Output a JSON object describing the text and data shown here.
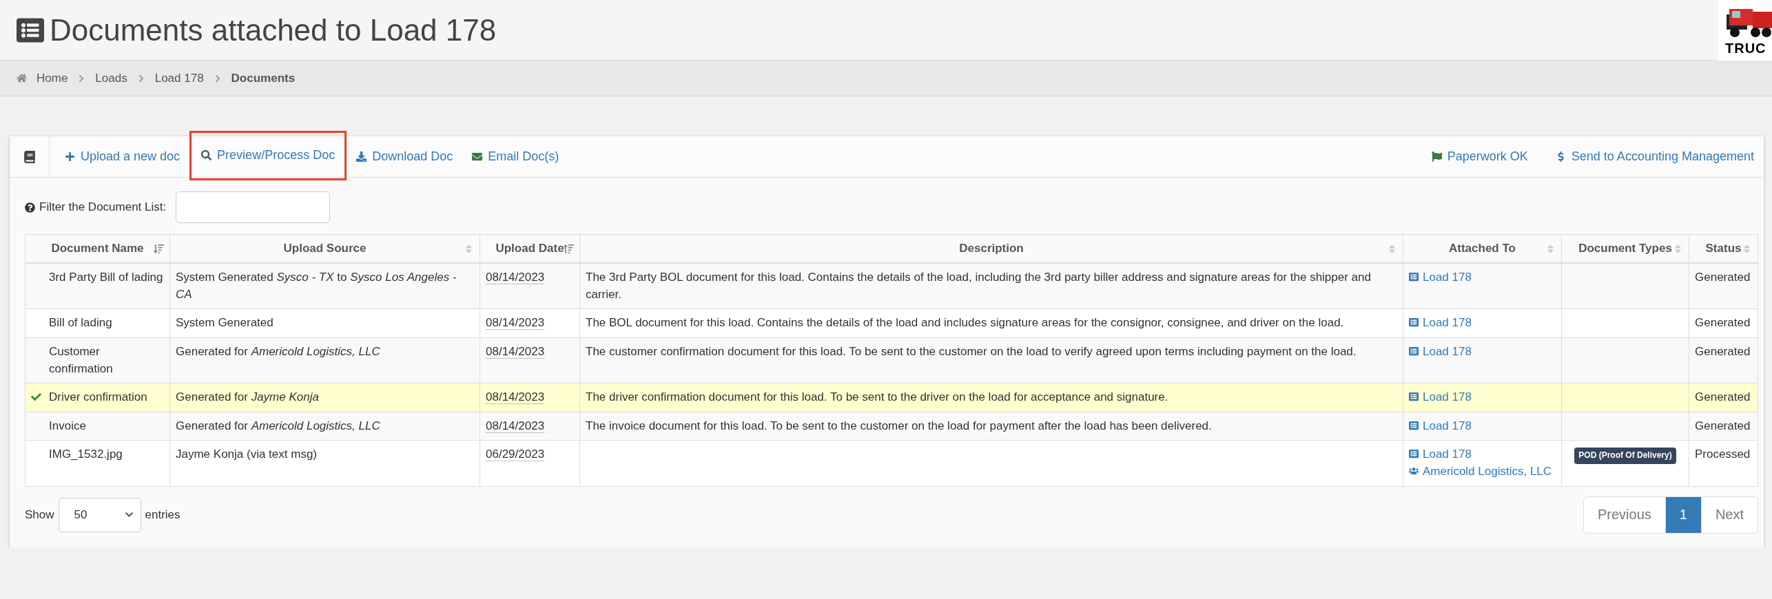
{
  "header": {
    "title": "Documents attached to Load 178",
    "logo_text": "TRUC"
  },
  "breadcrumb": [
    {
      "label": "Home",
      "kind": "home",
      "current": false
    },
    {
      "label": "Loads",
      "kind": "link",
      "current": false
    },
    {
      "label": "Load 178",
      "kind": "link",
      "current": false
    },
    {
      "label": "Documents",
      "kind": "link",
      "current": true
    }
  ],
  "toolbar": {
    "left": [
      {
        "label": "Upload a new doc",
        "highlighted": false
      },
      {
        "label": "Preview/Process Doc",
        "highlighted": true
      },
      {
        "label": "Download Doc",
        "highlighted": false
      },
      {
        "label": "Email Doc(s)",
        "highlighted": false
      }
    ],
    "right": [
      {
        "label": "Paperwork OK",
        "highlighted": false
      },
      {
        "label": "Send to Accounting Management",
        "highlighted": false
      }
    ]
  },
  "filter": {
    "label": "Filter the Document List:"
  },
  "table": {
    "columns": [
      {
        "label": "Document Name",
        "sorted": true,
        "descending": false
      },
      {
        "label": "Upload Source",
        "sorted": false
      },
      {
        "label": "Upload Date",
        "sorted": true,
        "descending": true
      },
      {
        "label": "Description",
        "sorted": false
      },
      {
        "label": "Attached To",
        "sorted": false
      },
      {
        "label": "Document Types",
        "sorted": false
      },
      {
        "label": "Status",
        "sorted": false
      }
    ],
    "rows": [
      {
        "name": "3rd Party Bill of lading",
        "source": "System Generated *Sysco - TX* to *Sysco Los Angeles - CA*",
        "date": "08/14/2023",
        "description": "The 3rd Party BOL document for this load. Contains the details of the load, including the 3rd party biller address and signature areas for the shipper and carrier.",
        "attached": [
          {
            "label": "Load 178",
            "kind": "load"
          }
        ],
        "status": "Generated",
        "selected": false
      },
      {
        "name": "Bill of lading",
        "source": "System Generated",
        "date": "08/14/2023",
        "description": "The BOL document for this load. Contains the details of the load and includes signature areas for the consignor, consignee, and driver on the load.",
        "attached": [
          {
            "label": "Load 178",
            "kind": "load"
          }
        ],
        "status": "Generated",
        "selected": false
      },
      {
        "name": "Customer confirmation",
        "source": "Generated for *Americold Logistics, LLC*",
        "date": "08/14/2023",
        "description": "The customer confirmation document for this load. To be sent to the customer on the load to verify agreed upon terms including payment on the load.",
        "attached": [
          {
            "label": "Load 178",
            "kind": "load"
          }
        ],
        "status": "Generated",
        "selected": false
      },
      {
        "name": "Driver confirmation",
        "source": "Generated for *Jayme Konja*",
        "date": "08/14/2023",
        "description": "The driver confirmation document for this load. To be sent to the driver on the load for acceptance and signature.",
        "attached": [
          {
            "label": "Load 178",
            "kind": "load"
          }
        ],
        "status": "Generated",
        "selected": true
      },
      {
        "name": "Invoice",
        "source": "Generated for *Americold Logistics, LLC*",
        "date": "08/14/2023",
        "description": "The invoice document for this load. To be sent to the customer on the load for payment after the load has been delivered.",
        "attached": [
          {
            "label": "Load 178",
            "kind": "load"
          }
        ],
        "status": "Generated",
        "selected": false
      },
      {
        "name": "IMG_1532.jpg",
        "source": "Jayme Konja (via text msg)",
        "date": "06/29/2023",
        "attached": [
          {
            "label": "Load 178",
            "kind": "load"
          },
          {
            "label": "Americold Logistics, LLC",
            "kind": "customer"
          }
        ],
        "types": [
          "POD (Proof Of Delivery)"
        ],
        "status": "Processed",
        "selected": false
      }
    ]
  },
  "footer": {
    "show_label": "Show",
    "page_size": "50",
    "entries_label": "entries",
    "pagination": [
      {
        "label": "Previous",
        "selected": false
      },
      {
        "label": "1",
        "selected": true
      },
      {
        "label": "Next",
        "selected": false
      }
    ]
  }
}
